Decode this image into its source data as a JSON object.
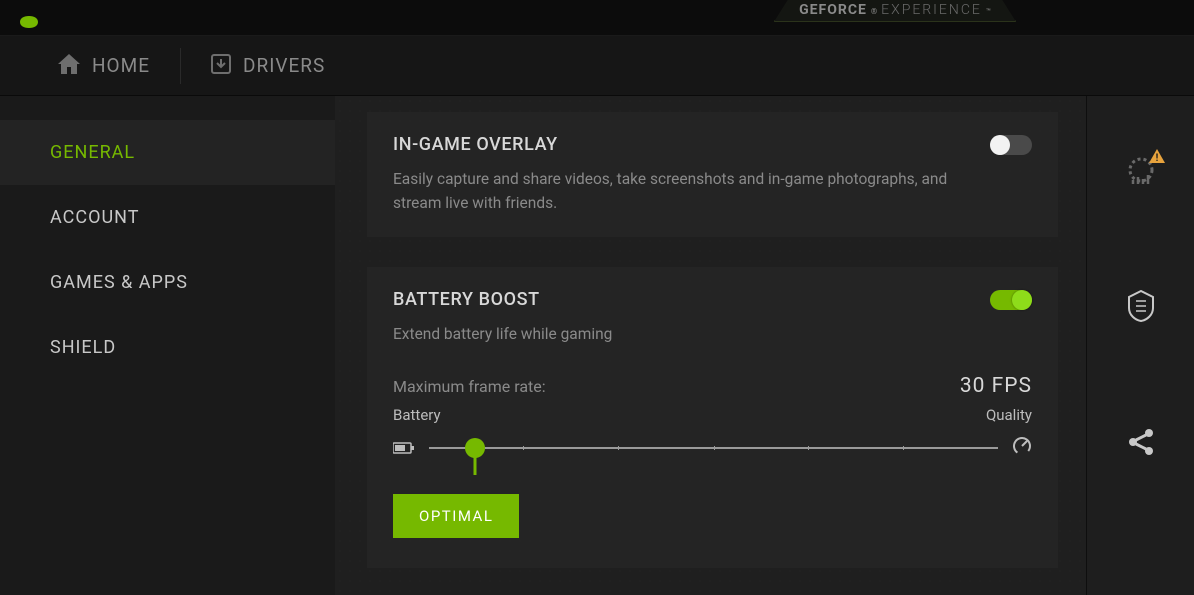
{
  "branding": {
    "bold": "GEFORCE",
    "reg": "®",
    "light": "EXPERIENCE",
    "tm": "™"
  },
  "nav": {
    "home": "HOME",
    "drivers": "DRIVERS"
  },
  "sidebar": {
    "items": [
      {
        "label": "GENERAL",
        "active": true
      },
      {
        "label": "ACCOUNT"
      },
      {
        "label": "GAMES & APPS"
      },
      {
        "label": "SHIELD"
      }
    ]
  },
  "overlay": {
    "title": "IN-GAME OVERLAY",
    "desc": "Easily capture and share videos, take screenshots and in-game photographs, and stream live with friends.",
    "enabled": false
  },
  "battery": {
    "title": "BATTERY BOOST",
    "desc": "Extend battery life while gaming",
    "enabled": true,
    "frame_label": "Maximum frame rate:",
    "fps_value": "30 FPS",
    "left_label": "Battery",
    "right_label": "Quality",
    "slider_percent": 8,
    "optimal_label": "OPTIMAL"
  }
}
